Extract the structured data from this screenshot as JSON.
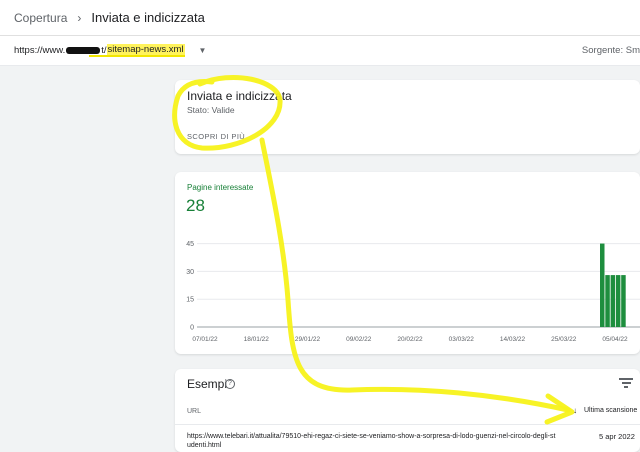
{
  "breadcrumb": {
    "parent": "Copertura",
    "separator": "›",
    "current": "Inviata e indicizzata"
  },
  "property": {
    "url_prefix": "https://www.",
    "url_slash": "t/",
    "url_highlight": "sitemap-news.xml",
    "source_label": "Sorgente: Sm"
  },
  "status_card": {
    "title": "Inviata e indicizzata",
    "status": "Stato: Valide",
    "link": "SCOPRI DI PIÙ"
  },
  "metric": {
    "label": "Pagine interessate",
    "value": "28"
  },
  "chart_data": {
    "type": "bar",
    "yticks": [
      0,
      15,
      30,
      45
    ],
    "ylim": [
      0,
      48
    ],
    "xticks": [
      "07/01/22",
      "18/01/22",
      "29/01/22",
      "09/02/22",
      "20/02/22",
      "03/03/22",
      "14/03/22",
      "25/03/22",
      "05/04/22"
    ],
    "x": [
      "01/04/22",
      "02/04/22",
      "03/04/22",
      "04/04/22",
      "05/04/22"
    ],
    "values": [
      45,
      28,
      28,
      28,
      28
    ],
    "color": "#1e8e3e"
  },
  "examples": {
    "title": "Esempi",
    "col_url": "URL",
    "col_last": "Ultima scansione",
    "rows": [
      {
        "url": "https://www.telebari.it/attualita/79510-ehi-regaz-ci-siete-se-veniamo-show-a-sorpresa-di-lodo-guenzi-nel-circolo-degli-studenti.html",
        "date": "5 apr 2022"
      }
    ]
  },
  "colors": {
    "accent_green": "#188038",
    "bar_green": "#1e8e3e",
    "annotation_yellow": "#f7f21a"
  }
}
